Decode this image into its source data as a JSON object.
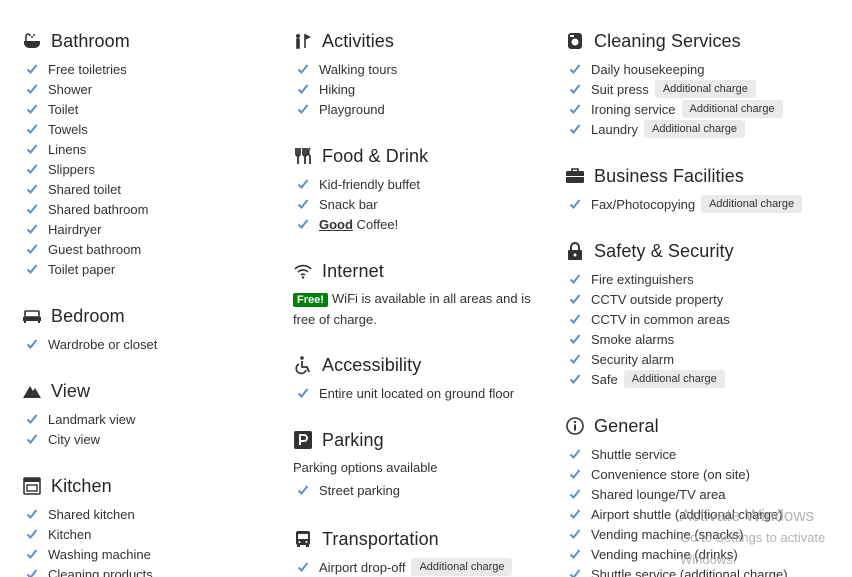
{
  "colors": {
    "check": "#5e8fc4",
    "free_badge": "#008009",
    "badge_bg": "#eaeaea"
  },
  "watermark": {
    "title": "Activate Windows",
    "subtitle": "Go to Settings to activate Windows."
  },
  "bathroom": {
    "title": "Bathroom",
    "icon": "bath-icon",
    "items": [
      "Free toiletries",
      "Shower",
      "Toilet",
      "Towels",
      "Linens",
      "Slippers",
      "Shared toilet",
      "Shared bathroom",
      "Hairdryer",
      "Guest bathroom",
      "Toilet paper"
    ]
  },
  "bedroom": {
    "title": "Bedroom",
    "icon": "bed-icon",
    "items": [
      "Wardrobe or closet"
    ]
  },
  "view": {
    "title": "View",
    "icon": "mountain-icon",
    "items": [
      "Landmark view",
      "City view"
    ]
  },
  "kitchen": {
    "title": "Kitchen",
    "icon": "oven-icon",
    "items": [
      "Shared kitchen",
      "Kitchen",
      "Washing machine",
      "Cleaning products"
    ]
  },
  "activities": {
    "title": "Activities",
    "icon": "activities-icon",
    "items": [
      "Walking tours",
      "Hiking",
      "Playground"
    ]
  },
  "food": {
    "title": "Food & Drink",
    "icon": "cutlery-icon",
    "items": [
      "Kid-friendly buffet",
      "Snack bar"
    ],
    "good": "Good",
    "coffee": " Coffee!"
  },
  "internet": {
    "title": "Internet",
    "icon": "wifi-icon",
    "free": "Free!",
    "text": "WiFi is available in all areas and is free of charge."
  },
  "accessibility": {
    "title": "Accessibility",
    "icon": "wheelchair-icon",
    "items": [
      "Entire unit located on ground floor"
    ]
  },
  "parking": {
    "title": "Parking",
    "icon": "parking-icon",
    "options": "Parking options available",
    "items": [
      "Street parking"
    ]
  },
  "transportation": {
    "title": "Transportation",
    "icon": "bus-icon",
    "item": "Airport drop-off",
    "badge": "Additional charge"
  },
  "cleaning": {
    "title": "Cleaning Services",
    "icon": "cleaning-icon",
    "items": [
      {
        "label": "Daily housekeeping",
        "badge": ""
      },
      {
        "label": "Suit press",
        "badge": "Additional charge"
      },
      {
        "label": "Ironing service",
        "badge": "Additional charge"
      },
      {
        "label": "Laundry",
        "badge": "Additional charge"
      }
    ]
  },
  "business": {
    "title": "Business Facilities",
    "icon": "briefcase-icon",
    "item": "Fax/Photocopying",
    "badge": "Additional charge"
  },
  "safety": {
    "title": "Safety & Security",
    "icon": "lock-icon",
    "items": [
      {
        "label": "Fire extinguishers",
        "badge": ""
      },
      {
        "label": "CCTV outside property",
        "badge": ""
      },
      {
        "label": "CCTV in common areas",
        "badge": ""
      },
      {
        "label": "Smoke alarms",
        "badge": ""
      },
      {
        "label": "Security alarm",
        "badge": ""
      },
      {
        "label": "Safe",
        "badge": "Additional charge"
      }
    ]
  },
  "general": {
    "title": "General",
    "icon": "info-icon",
    "items": [
      "Shuttle service",
      "Convenience store (on site)",
      "Shared lounge/TV area",
      "Airport shuttle (additional charge)",
      "Vending machine (snacks)",
      "Vending machine (drinks)",
      "Shuttle service (additional charge)"
    ]
  }
}
